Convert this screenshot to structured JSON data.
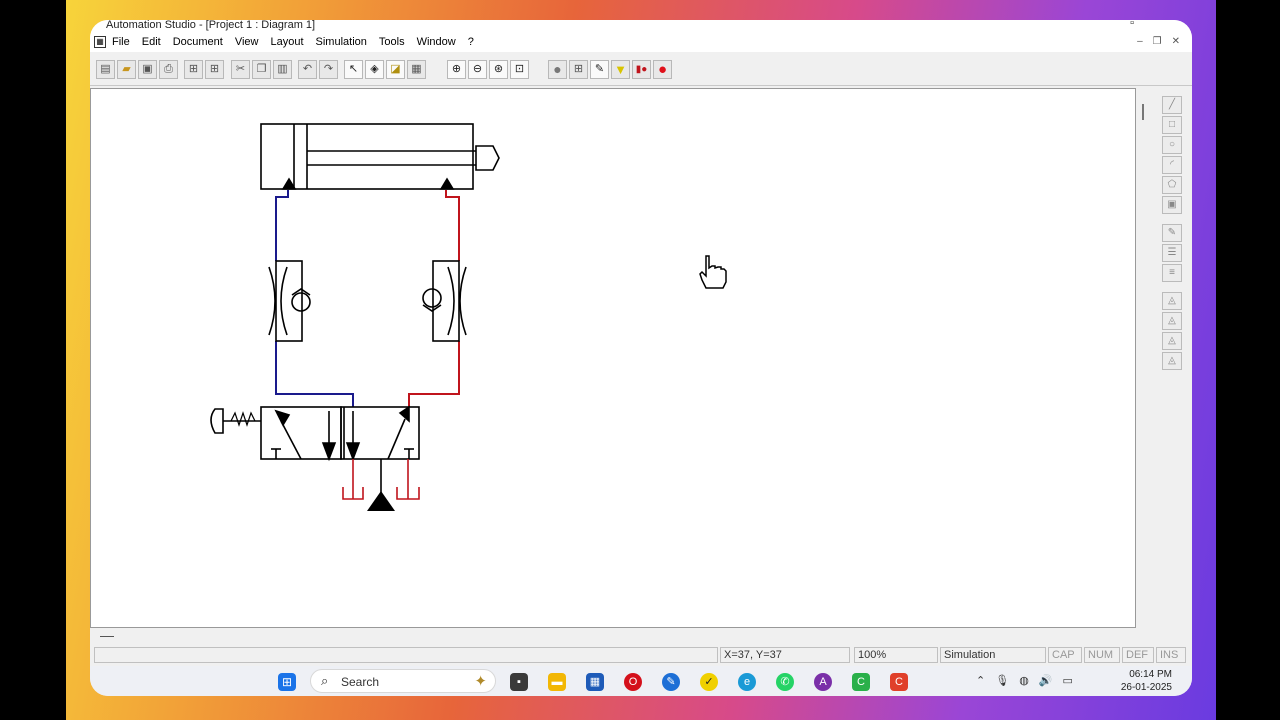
{
  "window": {
    "title": "Automation Studio - [Project 1 : Diagram 1]"
  },
  "menu": {
    "items": [
      "File",
      "Edit",
      "Document",
      "View",
      "Layout",
      "Simulation",
      "Tools",
      "Window",
      "?"
    ]
  },
  "window_controls": {
    "minimize": "–",
    "restore": "❐",
    "close": "✕"
  },
  "toolbar": {
    "buttons": [
      {
        "name": "new-project",
        "icon": "new-icon"
      },
      {
        "name": "open",
        "icon": "folder-open-icon"
      },
      {
        "name": "save",
        "icon": "floppy-icon"
      },
      {
        "name": "print",
        "icon": "printer-icon"
      },
      {
        "name": "insert-a",
        "icon": "insert-icon"
      },
      {
        "name": "insert-b",
        "icon": "insert-icon"
      },
      {
        "name": "cut",
        "icon": "scissors-icon"
      },
      {
        "name": "copy",
        "icon": "copy-icon"
      },
      {
        "name": "paste",
        "icon": "paste-icon"
      },
      {
        "name": "undo",
        "icon": "undo-icon"
      },
      {
        "name": "redo",
        "icon": "redo-icon"
      },
      {
        "name": "select",
        "icon": "pointer-icon"
      },
      {
        "name": "layers",
        "icon": "layers-icon"
      },
      {
        "name": "library",
        "icon": "library-icon"
      },
      {
        "name": "properties",
        "icon": "properties-icon"
      },
      {
        "name": "zoom-in",
        "icon": "zoom-in-icon"
      },
      {
        "name": "zoom-out",
        "icon": "zoom-out-icon"
      },
      {
        "name": "zoom-fit",
        "icon": "zoom-fit-icon"
      },
      {
        "name": "zoom-window",
        "icon": "zoom-window-icon"
      },
      {
        "name": "sim-normal",
        "icon": "circle-gray-icon"
      },
      {
        "name": "sim-step",
        "icon": "step-icon"
      },
      {
        "name": "sim-slow",
        "icon": "slow-icon"
      },
      {
        "name": "sim-pause",
        "icon": "yellow-triangle-icon"
      },
      {
        "name": "sim-stop-play",
        "icon": "pause-icon"
      },
      {
        "name": "sim-stop",
        "icon": "red-circle-icon"
      }
    ]
  },
  "status": {
    "coords": "X=37, Y=37",
    "zoom": "100%",
    "mode": "Simulation",
    "cap": "CAP",
    "num": "NUM",
    "def": "DEF",
    "ins": "INS"
  },
  "taskbar": {
    "search_label": "Search",
    "time": "06:14 PM",
    "date": "26-01-2025"
  },
  "colors": {
    "pressure_line": "#c0141c",
    "exhaust_line": "#1a1a8c",
    "tank": "#c0141c"
  }
}
